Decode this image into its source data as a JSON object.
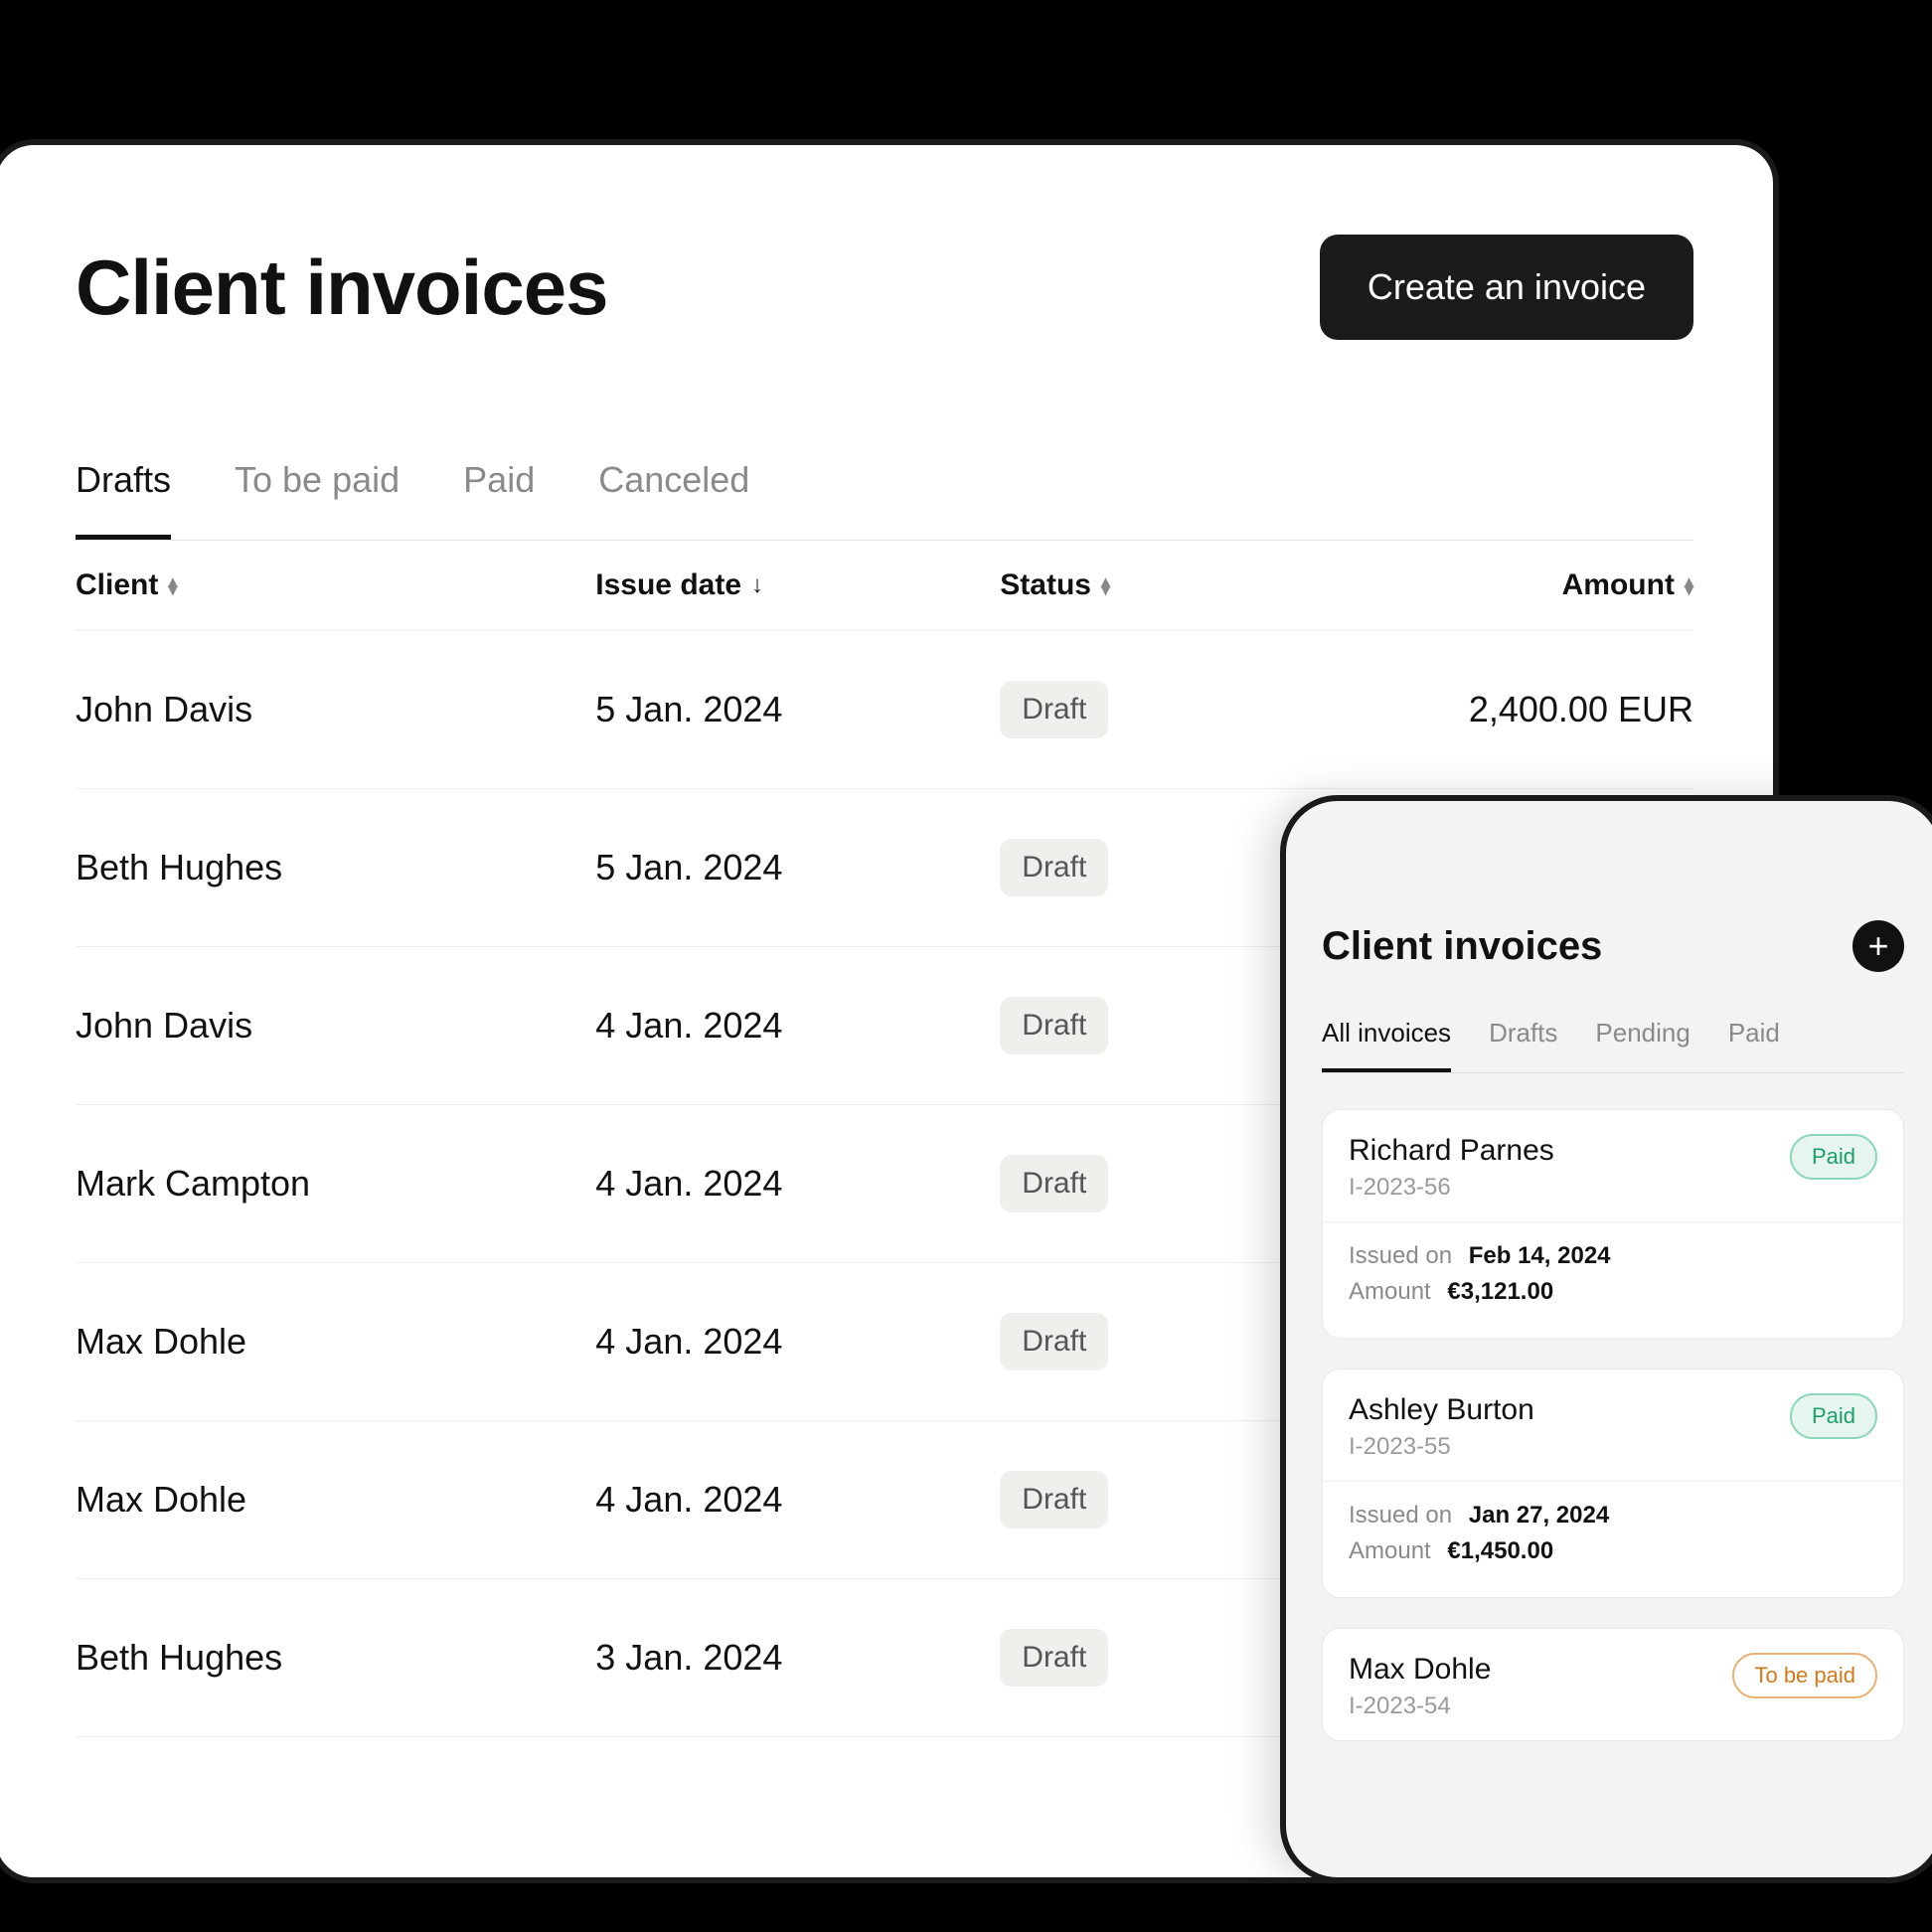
{
  "desktop": {
    "title": "Client invoices",
    "create_label": "Create an invoice",
    "tabs": [
      "Drafts",
      "To be paid",
      "Paid",
      "Canceled"
    ],
    "active_tab": 0,
    "columns": {
      "client": "Client",
      "issue": "Issue date",
      "status": "Status",
      "amount": "Amount"
    },
    "rows": [
      {
        "client": "John Davis",
        "issue": "5 Jan. 2024",
        "status": "Draft",
        "amount": "2,400.00 EUR"
      },
      {
        "client": "Beth Hughes",
        "issue": "5 Jan. 2024",
        "status": "Draft",
        "amount": ""
      },
      {
        "client": "John Davis",
        "issue": "4 Jan. 2024",
        "status": "Draft",
        "amount": ""
      },
      {
        "client": "Mark Campton",
        "issue": "4 Jan. 2024",
        "status": "Draft",
        "amount": ""
      },
      {
        "client": "Max Dohle",
        "issue": "4 Jan. 2024",
        "status": "Draft",
        "amount": ""
      },
      {
        "client": "Max Dohle",
        "issue": "4 Jan. 2024",
        "status": "Draft",
        "amount": ""
      },
      {
        "client": "Beth Hughes",
        "issue": "3 Jan. 2024",
        "status": "Draft",
        "amount": ""
      }
    ]
  },
  "mobile": {
    "title": "Client invoices",
    "tabs": [
      "All invoices",
      "Drafts",
      "Pending",
      "Paid"
    ],
    "active_tab": 0,
    "issued_label": "Issued on",
    "amount_label": "Amount",
    "cards": [
      {
        "name": "Richard Parnes",
        "id": "I-2023-56",
        "status": "Paid",
        "status_class": "paid",
        "issued": "Feb 14, 2024",
        "amount": "€3,121.00"
      },
      {
        "name": "Ashley Burton",
        "id": "I-2023-55",
        "status": "Paid",
        "status_class": "paid",
        "issued": "Jan 27, 2024",
        "amount": "€1,450.00"
      },
      {
        "name": "Max Dohle",
        "id": "I-2023-54",
        "status": "To be paid",
        "status_class": "tobepaid",
        "issued": "",
        "amount": ""
      }
    ]
  }
}
